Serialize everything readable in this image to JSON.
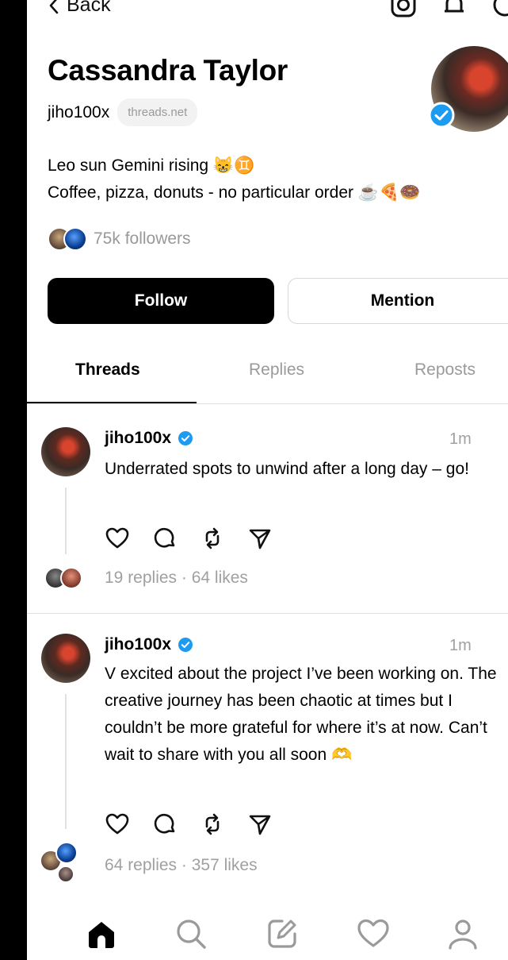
{
  "header": {
    "back_label": "Back"
  },
  "profile": {
    "name": "Cassandra Taylor",
    "handle": "jiho100x",
    "domain": "threads.net",
    "bio_line1": "Leo sun Gemini rising 😸♊",
    "bio_line2": "Coffee, pizza, donuts - no particular order ☕🍕🍩",
    "followers": "75k followers"
  },
  "buttons": {
    "follow": "Follow",
    "mention": "Mention"
  },
  "tabs": [
    {
      "label": "Threads",
      "active": true
    },
    {
      "label": "Replies",
      "active": false
    },
    {
      "label": "Reposts",
      "active": false
    }
  ],
  "posts": [
    {
      "author": "jiho100x",
      "time": "1m",
      "text": "Underrated spots to unwind after a long day – go!",
      "stats": "19 replies · 64 likes"
    },
    {
      "author": "jiho100x",
      "time": "1m",
      "text": "V excited about the project I’ve been working on. The creative journey has been chaotic at times but I couldn’t be more grateful for where it’s at now. Can’t wait to share with you all soon 🫶",
      "stats": "64 replies · 357 likes"
    }
  ],
  "colors": {
    "verified": "#1d9bf0",
    "muted": "#999999",
    "divider": "#e1e1e1",
    "primary_button": "#000000"
  },
  "icons": {
    "top": [
      "instagram-icon",
      "notifications-icon",
      "menu-icon"
    ],
    "post_actions": [
      "heart-icon",
      "comment-icon",
      "repost-icon",
      "share-icon"
    ],
    "nav": [
      "home-icon",
      "search-icon",
      "compose-icon",
      "activity-heart-icon",
      "profile-icon"
    ]
  }
}
